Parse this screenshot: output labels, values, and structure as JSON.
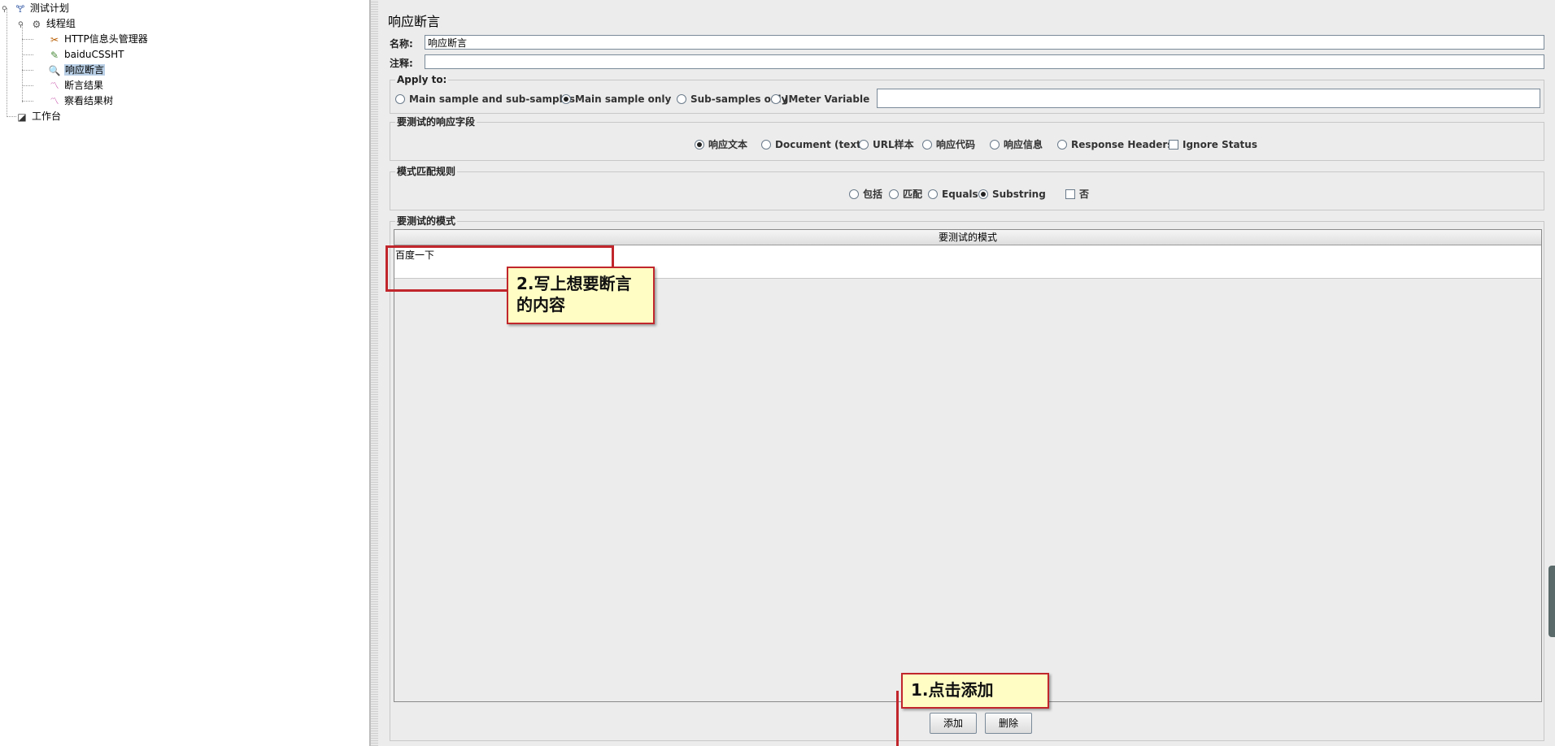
{
  "tree": {
    "items": [
      {
        "label": "测试计划",
        "icon": "flask-icon"
      },
      {
        "label": "线程组",
        "icon": "gear-icon"
      },
      {
        "label": "HTTP信息头管理器",
        "icon": "wrench-icon"
      },
      {
        "label": "baiduCSSHT",
        "icon": "pen-icon"
      },
      {
        "label": "响应断言",
        "icon": "magnifier-icon"
      },
      {
        "label": "断言结果",
        "icon": "chart-icon"
      },
      {
        "label": "察看结果树",
        "icon": "chart-icon"
      },
      {
        "label": "工作台",
        "icon": "workbench-icon"
      }
    ]
  },
  "panel": {
    "title": "响应断言",
    "name_label": "名称:",
    "name_value": "响应断言",
    "comment_label": "注释:",
    "comment_value": "",
    "apply_to": {
      "title": "Apply to:",
      "options": [
        "Main sample and sub-samples",
        "Main sample only",
        "Sub-samples only",
        "JMeter Variable"
      ],
      "selected": "Main sample only",
      "variable_value": ""
    },
    "response_field": {
      "title": "要测试的响应字段",
      "options": [
        "响应文本",
        "Document (text)",
        "URL样本",
        "响应代码",
        "响应信息",
        "Response Headers"
      ],
      "selected": "响应文本",
      "ignore_status": "Ignore Status"
    },
    "pattern_rules": {
      "title": "模式匹配规则",
      "options": [
        "包括",
        "匹配",
        "Equals",
        "Substring"
      ],
      "selected": "Substring",
      "not_label": "否"
    },
    "patterns": {
      "title": "要测试的模式",
      "column_header": "要测试的模式",
      "rows": [
        "百度一下"
      ]
    },
    "buttons": {
      "add": "添加",
      "delete": "删除"
    }
  },
  "annotations": {
    "step2": "2.写上想要断言的内容",
    "step1": "1.点击添加"
  },
  "colors": {
    "callout_border": "#c0262c",
    "callout_bg": "#fffdc4",
    "selection": "#b8cfe5"
  }
}
